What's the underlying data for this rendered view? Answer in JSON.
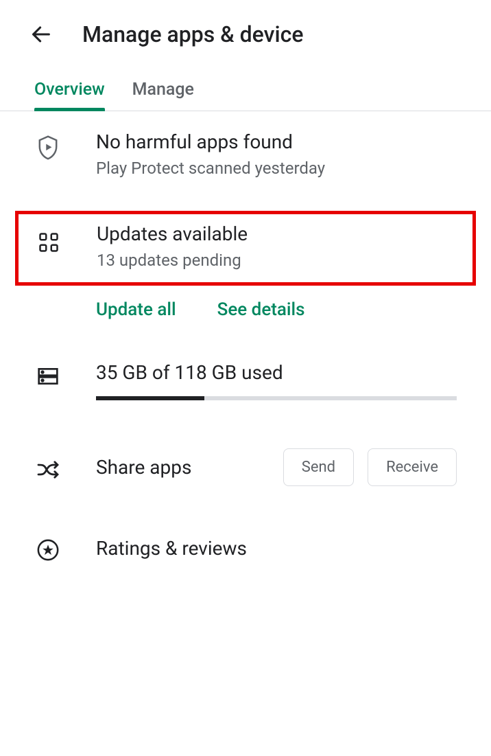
{
  "header": {
    "title": "Manage apps & device"
  },
  "tabs": {
    "overview": "Overview",
    "manage": "Manage"
  },
  "protect": {
    "title": "No harmful apps found",
    "subtitle": "Play Protect scanned yesterday"
  },
  "updates": {
    "title": "Updates available",
    "subtitle": "13 updates pending",
    "update_all": "Update all",
    "see_details": "See details"
  },
  "storage": {
    "title": "35 GB of 118 GB used",
    "used": 35,
    "total": 118
  },
  "share": {
    "title": "Share apps",
    "send": "Send",
    "receive": "Receive"
  },
  "ratings": {
    "title": "Ratings & reviews"
  }
}
